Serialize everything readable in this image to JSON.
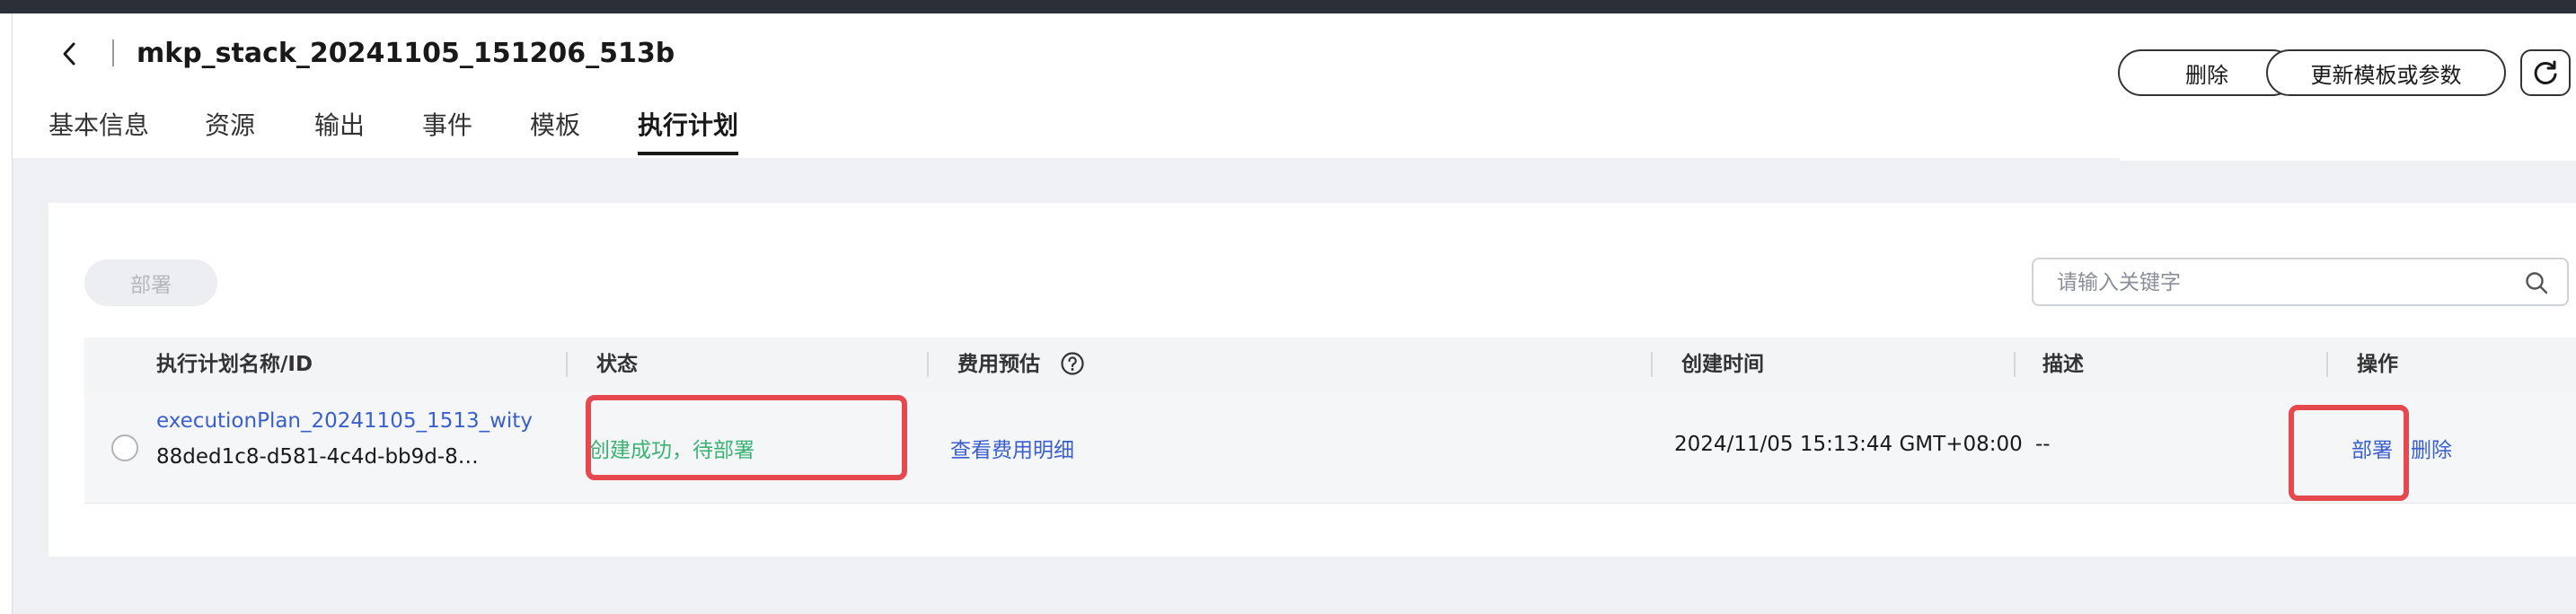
{
  "header": {
    "title": "mkp_stack_20241105_151206_513b",
    "delete_label": "删除",
    "update_label": "更新模板或参数"
  },
  "tabs": [
    {
      "label": "基本信息",
      "active": false
    },
    {
      "label": "资源",
      "active": false
    },
    {
      "label": "输出",
      "active": false
    },
    {
      "label": "事件",
      "active": false
    },
    {
      "label": "模板",
      "active": false
    },
    {
      "label": "执行计划",
      "active": true
    }
  ],
  "toolbar": {
    "deploy_label": "部署",
    "search_placeholder": "请输入关键字"
  },
  "table": {
    "columns": [
      "执行计划名称/ID",
      "状态",
      "费用预估",
      "创建时间",
      "描述",
      "操作"
    ],
    "rows": [
      {
        "name": "executionPlan_20241105_1513_wity",
        "id": "88ded1c8-d581-4c4d-bb9d-8…",
        "status": "创建成功，待部署",
        "cost": "查看费用明细",
        "created": "2024/11/05 15:13:44 GMT+08:00",
        "description": "--",
        "op_deploy": "部署",
        "op_delete": "删除"
      }
    ]
  },
  "colors": {
    "link": "#3a5fcd",
    "status_success": "#3bb273",
    "highlight": "#e5484d"
  },
  "icons": [
    "back-icon",
    "refresh-icon",
    "search-icon",
    "help-icon"
  ]
}
